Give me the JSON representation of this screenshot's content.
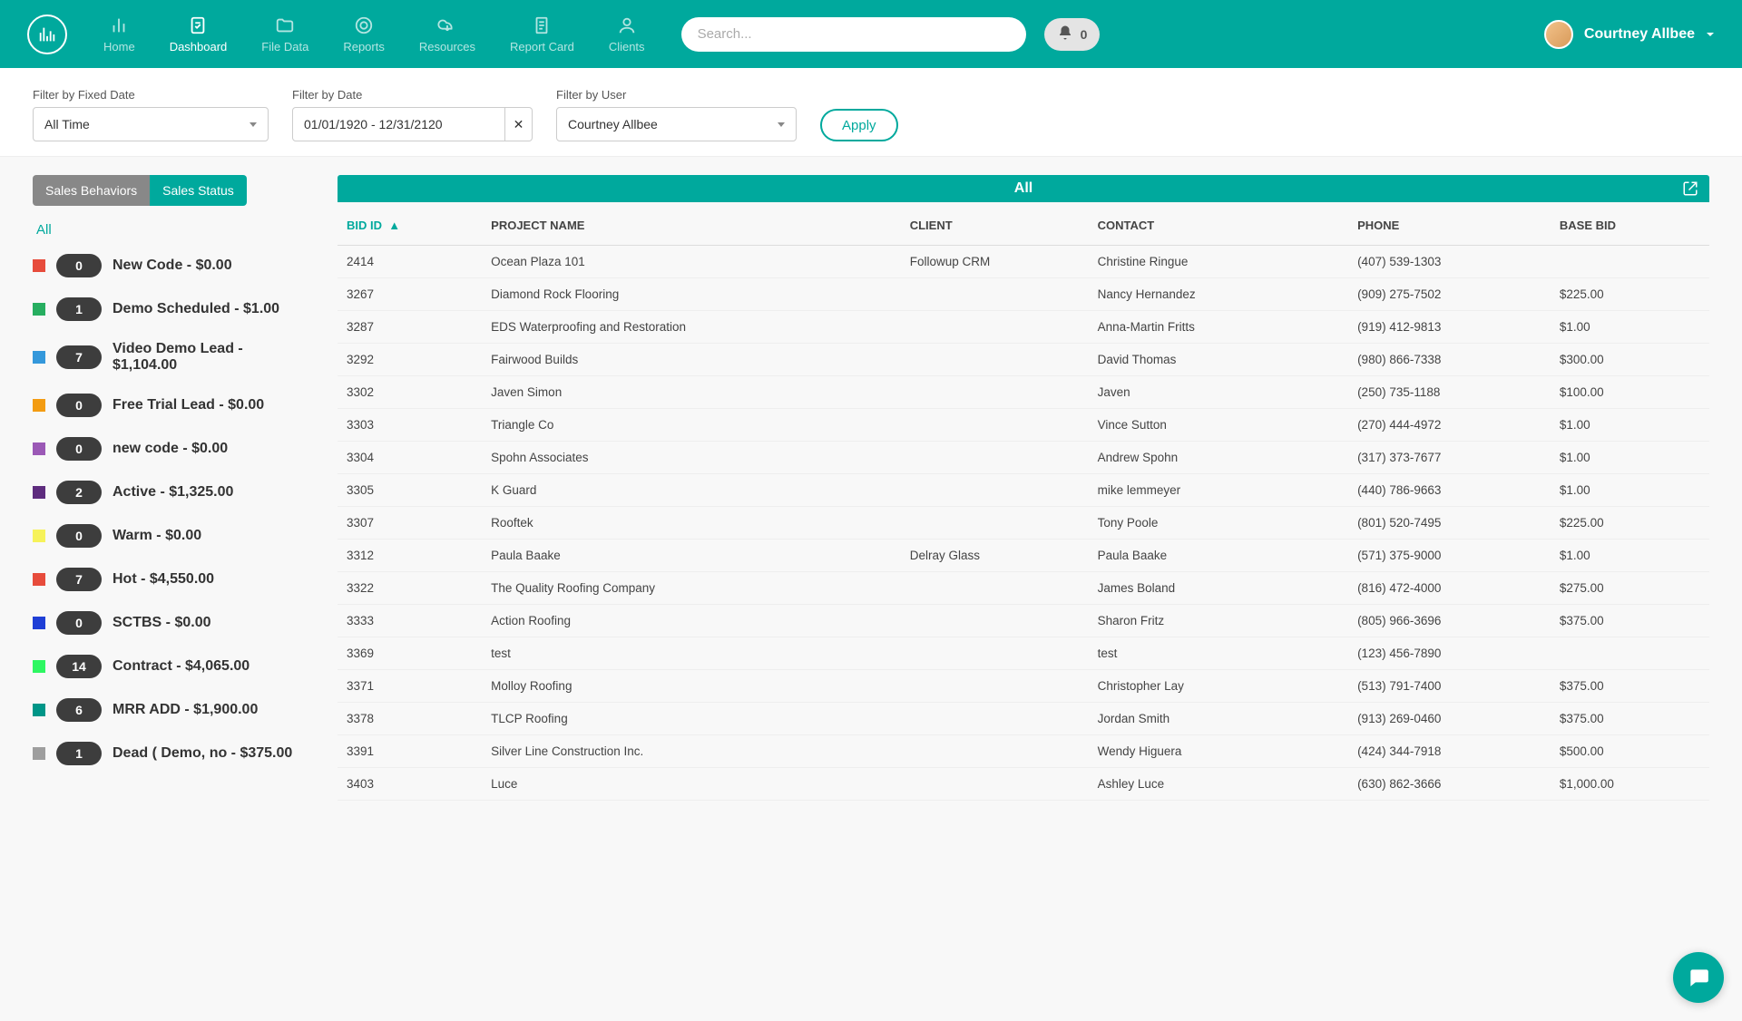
{
  "header": {
    "nav": [
      {
        "label": "Home"
      },
      {
        "label": "Dashboard"
      },
      {
        "label": "File Data"
      },
      {
        "label": "Reports"
      },
      {
        "label": "Resources"
      },
      {
        "label": "Report Card"
      },
      {
        "label": "Clients"
      }
    ],
    "search_placeholder": "Search...",
    "notif_count": "0",
    "user_name": "Courtney Allbee"
  },
  "filters": {
    "fixed_date_label": "Filter by Fixed Date",
    "fixed_date_value": "All Time",
    "date_label": "Filter by Date",
    "date_value": "01/01/1920 - 12/31/2120",
    "user_label": "Filter by User",
    "user_value": "Courtney Allbee",
    "apply_label": "Apply"
  },
  "sidebar": {
    "tab1": "Sales Behaviors",
    "tab2": "Sales Status",
    "all_label": "All",
    "statuses": [
      {
        "color": "#e74c3c",
        "count": "0",
        "label": "New Code - $0.00"
      },
      {
        "color": "#27ae60",
        "count": "1",
        "label": "Demo Scheduled - $1.00"
      },
      {
        "color": "#3498db",
        "count": "7",
        "label": "Video Demo Lead - $1,104.00"
      },
      {
        "color": "#f39c12",
        "count": "0",
        "label": "Free Trial Lead - $0.00"
      },
      {
        "color": "#9b59b6",
        "count": "0",
        "label": "new code - $0.00"
      },
      {
        "color": "#5e2c7e",
        "count": "2",
        "label": "Active - $1,325.00"
      },
      {
        "color": "#f6f25a",
        "count": "0",
        "label": "Warm - $0.00"
      },
      {
        "color": "#e74c3c",
        "count": "7",
        "label": "Hot - $4,550.00"
      },
      {
        "color": "#1f3fd6",
        "count": "0",
        "label": "SCTBS - $0.00"
      },
      {
        "color": "#2ef762",
        "count": "14",
        "label": "Contract - $4,065.00"
      },
      {
        "color": "#009688",
        "count": "6",
        "label": "MRR ADD - $1,900.00"
      },
      {
        "color": "#9e9e9e",
        "count": "1",
        "label": "Dead ( Demo, no - $375.00"
      }
    ]
  },
  "table": {
    "title": "All",
    "columns": {
      "bidid": "BID ID",
      "project": "PROJECT NAME",
      "client": "CLIENT",
      "contact": "CONTACT",
      "phone": "PHONE",
      "base": "BASE BID"
    },
    "rows": [
      {
        "id": "2414",
        "project": "Ocean Plaza 101",
        "client": "Followup CRM",
        "contact": "Christine Ringue",
        "phone": "(407) 539-1303",
        "base": ""
      },
      {
        "id": "3267",
        "project": "Diamond Rock Flooring",
        "client": "",
        "contact": "Nancy Hernandez",
        "phone": "(909) 275-7502",
        "base": "$225.00"
      },
      {
        "id": "3287",
        "project": "EDS Waterproofing and Restoration",
        "client": "",
        "contact": "Anna-Martin Fritts",
        "phone": "(919) 412-9813",
        "base": "$1.00"
      },
      {
        "id": "3292",
        "project": "Fairwood Builds",
        "client": "",
        "contact": "David Thomas",
        "phone": "(980) 866-7338",
        "base": "$300.00"
      },
      {
        "id": "3302",
        "project": "Javen Simon",
        "client": "",
        "contact": "Javen",
        "phone": "(250) 735-1188",
        "base": "$100.00"
      },
      {
        "id": "3303",
        "project": "Triangle Co",
        "client": "",
        "contact": "Vince Sutton",
        "phone": "(270) 444-4972",
        "base": "$1.00"
      },
      {
        "id": "3304",
        "project": "Spohn Associates",
        "client": "",
        "contact": "Andrew Spohn",
        "phone": "(317) 373-7677",
        "base": "$1.00"
      },
      {
        "id": "3305",
        "project": "K Guard",
        "client": "",
        "contact": "mike lemmeyer",
        "phone": "(440) 786-9663",
        "base": "$1.00"
      },
      {
        "id": "3307",
        "project": "Rooftek",
        "client": "",
        "contact": "Tony Poole",
        "phone": "(801) 520-7495",
        "base": "$225.00"
      },
      {
        "id": "3312",
        "project": "Paula Baake",
        "client": "Delray Glass",
        "contact": "Paula Baake",
        "phone": "(571) 375-9000",
        "base": "$1.00"
      },
      {
        "id": "3322",
        "project": "The Quality Roofing Company",
        "client": "",
        "contact": "James Boland",
        "phone": "(816) 472-4000",
        "base": "$275.00"
      },
      {
        "id": "3333",
        "project": "Action Roofing",
        "client": "",
        "contact": "Sharon Fritz",
        "phone": "(805) 966-3696",
        "base": "$375.00"
      },
      {
        "id": "3369",
        "project": "test",
        "client": "",
        "contact": "test",
        "phone": "(123) 456-7890",
        "base": ""
      },
      {
        "id": "3371",
        "project": "Molloy Roofing",
        "client": "",
        "contact": "Christopher Lay",
        "phone": "(513) 791-7400",
        "base": "$375.00"
      },
      {
        "id": "3378",
        "project": "TLCP Roofing",
        "client": "",
        "contact": "Jordan Smith",
        "phone": "(913) 269-0460",
        "base": "$375.00"
      },
      {
        "id": "3391",
        "project": "Silver Line Construction Inc.",
        "client": "",
        "contact": "Wendy Higuera",
        "phone": "(424) 344-7918",
        "base": "$500.00"
      },
      {
        "id": "3403",
        "project": "Luce",
        "client": "",
        "contact": "Ashley Luce",
        "phone": "(630) 862-3666",
        "base": "$1,000.00"
      }
    ]
  }
}
